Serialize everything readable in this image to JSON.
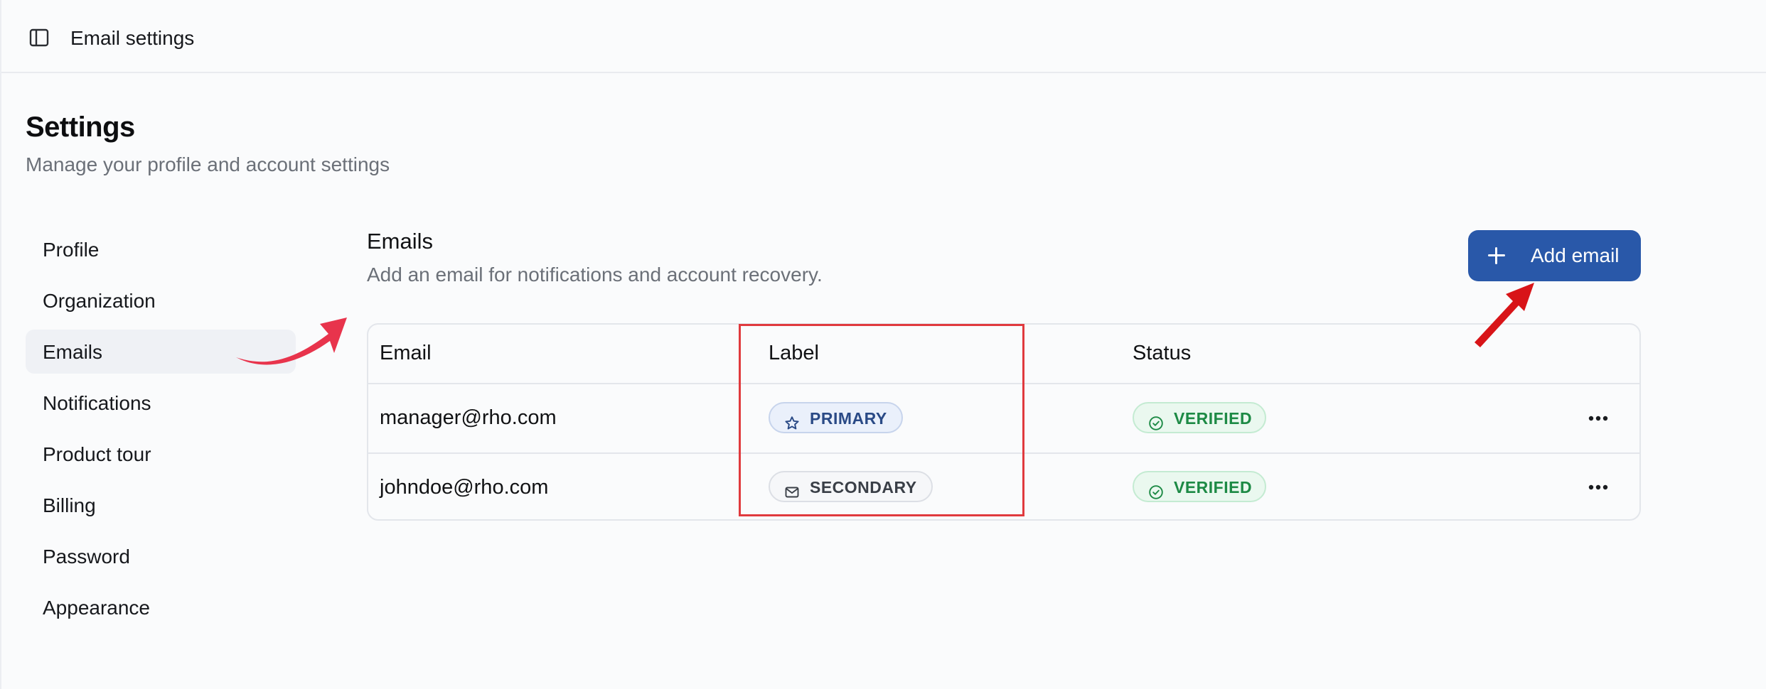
{
  "topbar": {
    "title": "Email settings",
    "toggle_icon": "sidebar-toggle-icon"
  },
  "page": {
    "title": "Settings",
    "subtitle": "Manage your profile and account settings"
  },
  "nav": {
    "items": [
      {
        "label": "Profile"
      },
      {
        "label": "Organization"
      },
      {
        "label": "Emails",
        "active": true
      },
      {
        "label": "Notifications"
      },
      {
        "label": "Product tour"
      },
      {
        "label": "Billing"
      },
      {
        "label": "Password"
      },
      {
        "label": "Appearance"
      }
    ]
  },
  "emails_section": {
    "title": "Emails",
    "description": "Add an email for notifications and account recovery.",
    "add_button_label": "Add email",
    "add_button_icon": "plus-icon",
    "table": {
      "columns": [
        "Email",
        "Label",
        "Status"
      ],
      "rows": [
        {
          "email": "manager@rho.com",
          "label": "PRIMARY",
          "label_icon": "star-icon",
          "status": "VERIFIED",
          "status_icon": "check-circle-icon"
        },
        {
          "email": "johndoe@rho.com",
          "label": "SECONDARY",
          "label_icon": "mail-icon",
          "status": "VERIFIED",
          "status_icon": "check-circle-icon"
        }
      ]
    }
  },
  "colors": {
    "accent": "#2958a9",
    "annotation_red": "#e03a3e",
    "verified_green": "#1d8a45",
    "primary_badge_text": "#2a4a86"
  }
}
